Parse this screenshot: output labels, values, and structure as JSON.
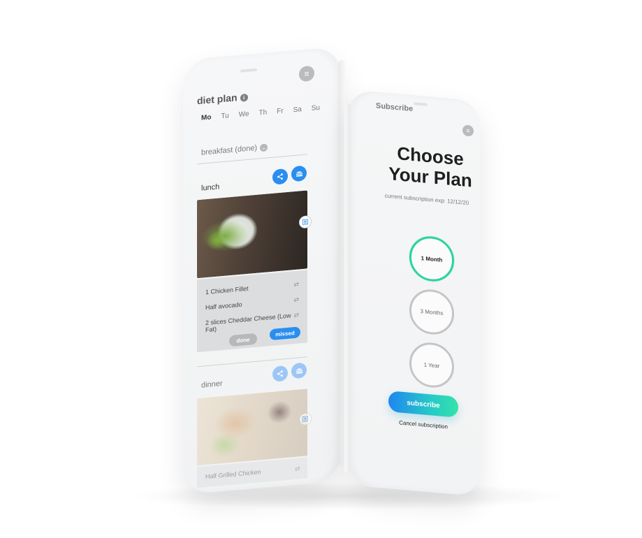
{
  "left_phone": {
    "title": "diet plan",
    "info_glyph": "i",
    "menu_glyph": "≡",
    "days": [
      "Mo",
      "Tu",
      "We",
      "Th",
      "Fr",
      "Sa",
      "Su"
    ],
    "active_day": "Mo",
    "breakfast_label": "breakfast (done)",
    "breakfast_chevron": "⌄",
    "lunch": {
      "label": "lunch",
      "share_icon": "share-icon",
      "burger_icon": "burger-icon",
      "ingredients": [
        {
          "name": "1 Chicken Fillet",
          "swap": "⇄"
        },
        {
          "name": "Half avocado",
          "swap": "⇄"
        },
        {
          "name": "2 slices Cheddar Cheese (Low Fat)",
          "swap": "⇄"
        }
      ],
      "done_label": "done",
      "missed_label": "missed"
    },
    "dinner": {
      "label": "dinner",
      "first_item": "Half Grilled Chicken",
      "swap": "⇄"
    },
    "accent_color": "#2a8ef0"
  },
  "right_phone": {
    "header": "Subscribe",
    "menu_glyph": "≡",
    "heading_line1": "Choose",
    "heading_line2": "Your Plan",
    "expiry_text": "current subscription exp: 12/12/20",
    "plans": [
      {
        "label": "1 Month",
        "selected": true
      },
      {
        "label": "3 Months",
        "selected": false
      },
      {
        "label": "1 Year",
        "selected": false
      }
    ],
    "subscribe_label": "subscribe",
    "cancel_label": "Cancel subscription",
    "selected_color": "#2bd3a0"
  }
}
